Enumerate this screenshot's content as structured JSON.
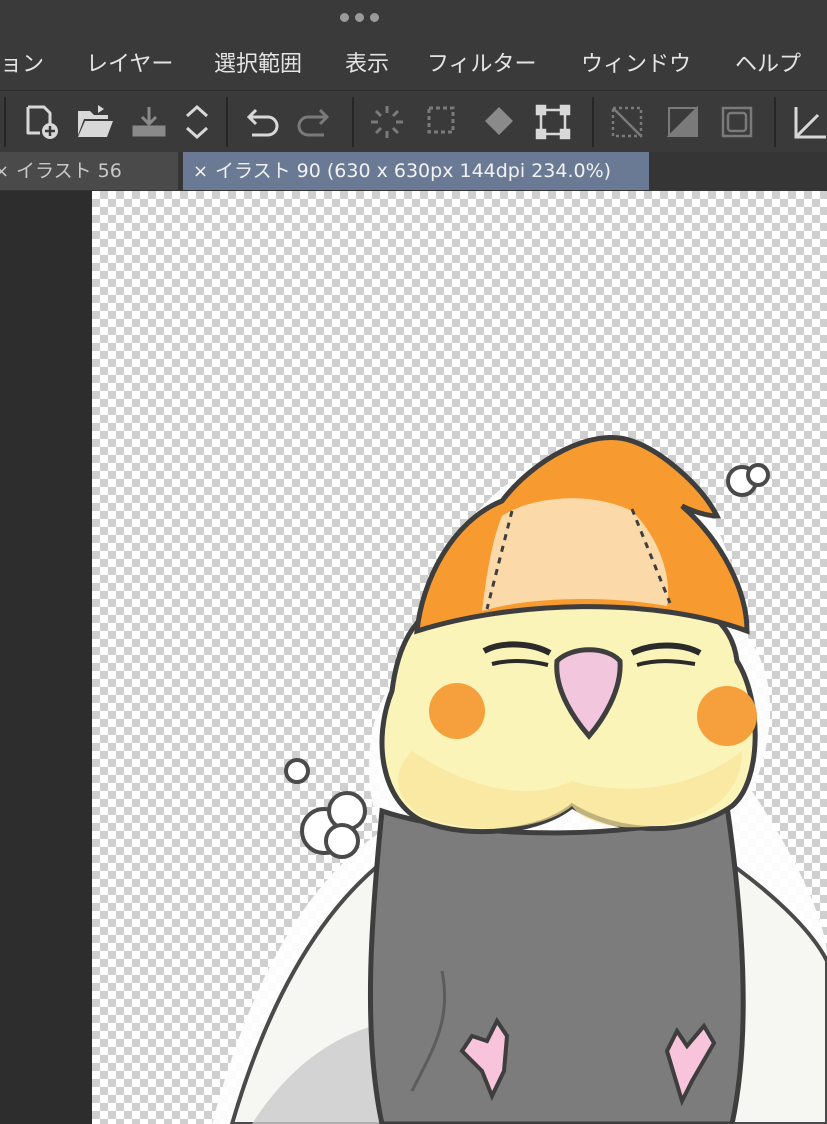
{
  "window": {
    "title_dots_icon": "more-dots-icon"
  },
  "menu": {
    "items": [
      {
        "label": "ョン"
      },
      {
        "label": "レイヤー"
      },
      {
        "label": "選択範囲"
      },
      {
        "label": "表示"
      },
      {
        "label": "フィルター"
      },
      {
        "label": "ウィンドウ"
      },
      {
        "label": "ヘルプ"
      }
    ]
  },
  "toolbar": {
    "icons": [
      "new-file-icon",
      "open-folder-icon",
      "save-icon",
      "up-down-arrows-icon",
      "undo-icon",
      "redo-icon",
      "loading-spinner-icon",
      "selection-dashed-icon",
      "fill-bucket-icon",
      "transform-icon",
      "clear-selection-icon",
      "fill-area-icon",
      "selection-border-icon",
      "ruler-icon"
    ]
  },
  "tabs": [
    {
      "label": "イラスト 56",
      "active": false,
      "close_glyph": "×"
    },
    {
      "label": "イラスト 90 (630 x 630px 144dpi 234.0%)",
      "active": true,
      "close_glyph": "×"
    }
  ],
  "colors": {
    "chrome_bg": "#3a3a3a",
    "active_tab": "#6a7a95",
    "inactive_tab": "#4a4a4a",
    "menu_text": "#e4e4e4",
    "bird_yellow": "#fbf4b8",
    "hat_orange": "#f79a30",
    "cheek_orange": "#f5a03c",
    "beak_pink": "#f2c6dc",
    "body_gray": "#7c7c7c"
  }
}
